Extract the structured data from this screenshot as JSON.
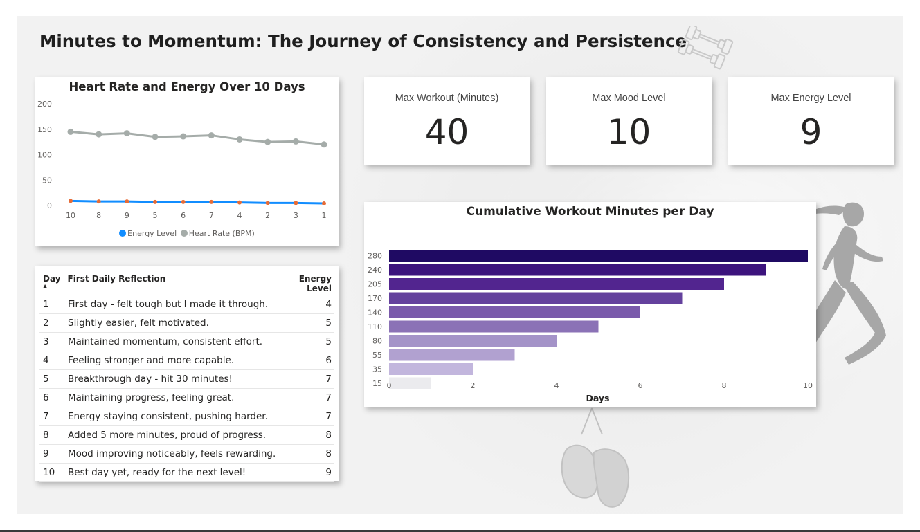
{
  "page": {
    "title": "Minutes to Momentum: The Journey of Consistency and Persistence"
  },
  "decorations": {
    "dumbbell": "dumbbell-icon",
    "runner": "runner-silhouette",
    "gloves": "boxing-gloves-icon"
  },
  "line_chart": {
    "title": "Heart Rate and Energy Over 10 Days",
    "legend": [
      "Energy Level",
      "Heart Rate (BPM)"
    ]
  },
  "kpis": [
    {
      "label": "Max Workout (Minutes)",
      "value": "40"
    },
    {
      "label": "Max Mood Level",
      "value": "10"
    },
    {
      "label": "Max Energy Level",
      "value": "9"
    }
  ],
  "table": {
    "headers": [
      "Day",
      "First Daily Reflection",
      "Energy Level"
    ],
    "sort": "ascending by Day",
    "rows": [
      [
        "1",
        "First day - felt tough but I made it through.",
        "4"
      ],
      [
        "2",
        "Slightly easier, felt motivated.",
        "5"
      ],
      [
        "3",
        "Maintained momentum, consistent effort.",
        "5"
      ],
      [
        "4",
        "Feeling stronger and more capable.",
        "6"
      ],
      [
        "5",
        "Breakthrough day - hit 30 minutes!",
        "7"
      ],
      [
        "6",
        "Maintaining progress, feeling great.",
        "7"
      ],
      [
        "7",
        "Energy staying consistent, pushing harder.",
        "7"
      ],
      [
        "8",
        "Added 5 more minutes, proud of progress.",
        "8"
      ],
      [
        "9",
        "Mood improving noticeably, feels rewarding.",
        "8"
      ],
      [
        "10",
        "Best day yet, ready for the next level!",
        "9"
      ]
    ]
  },
  "bar_chart": {
    "title": "Cumulative Workout Minutes per Day",
    "xlabel": "Days"
  },
  "chart_data": [
    {
      "type": "line",
      "title": "Heart Rate and Energy Over 10 Days",
      "categories": [
        "10",
        "8",
        "9",
        "5",
        "6",
        "7",
        "4",
        "2",
        "3",
        "1"
      ],
      "series": [
        {
          "name": "Energy Level",
          "values": [
            9,
            8,
            8,
            7,
            7,
            7,
            6,
            5,
            5,
            4
          ],
          "color": "#118dff",
          "marker_color": "#e66c37"
        },
        {
          "name": "Heart Rate (BPM)",
          "values": [
            145,
            140,
            142,
            135,
            136,
            138,
            130,
            125,
            126,
            120
          ],
          "color": "#a5aca9",
          "marker_color": "#a5aca9"
        }
      ],
      "ylim": [
        0,
        200
      ],
      "yticks": [
        0,
        50,
        100,
        150,
        200
      ],
      "grid": false,
      "legend_position": "bottom"
    },
    {
      "type": "bar",
      "orientation": "horizontal",
      "title": "Cumulative Workout Minutes per Day",
      "categories": [
        "280",
        "240",
        "205",
        "170",
        "140",
        "110",
        "80",
        "55",
        "35",
        "15"
      ],
      "values": [
        10,
        9,
        8,
        7,
        6,
        5,
        4,
        3,
        2,
        1
      ],
      "colors": [
        "#1f0a63",
        "#3c137d",
        "#52258f",
        "#64419d",
        "#7a5aab",
        "#8b72b6",
        "#a493c8",
        "#b1a1d0",
        "#c2b6dd",
        "#ebebee"
      ],
      "xlabel": "Days",
      "ylabel": "",
      "xlim": [
        0,
        10
      ],
      "xticks": [
        0,
        2,
        4,
        6,
        8,
        10
      ],
      "grid": false
    }
  ]
}
